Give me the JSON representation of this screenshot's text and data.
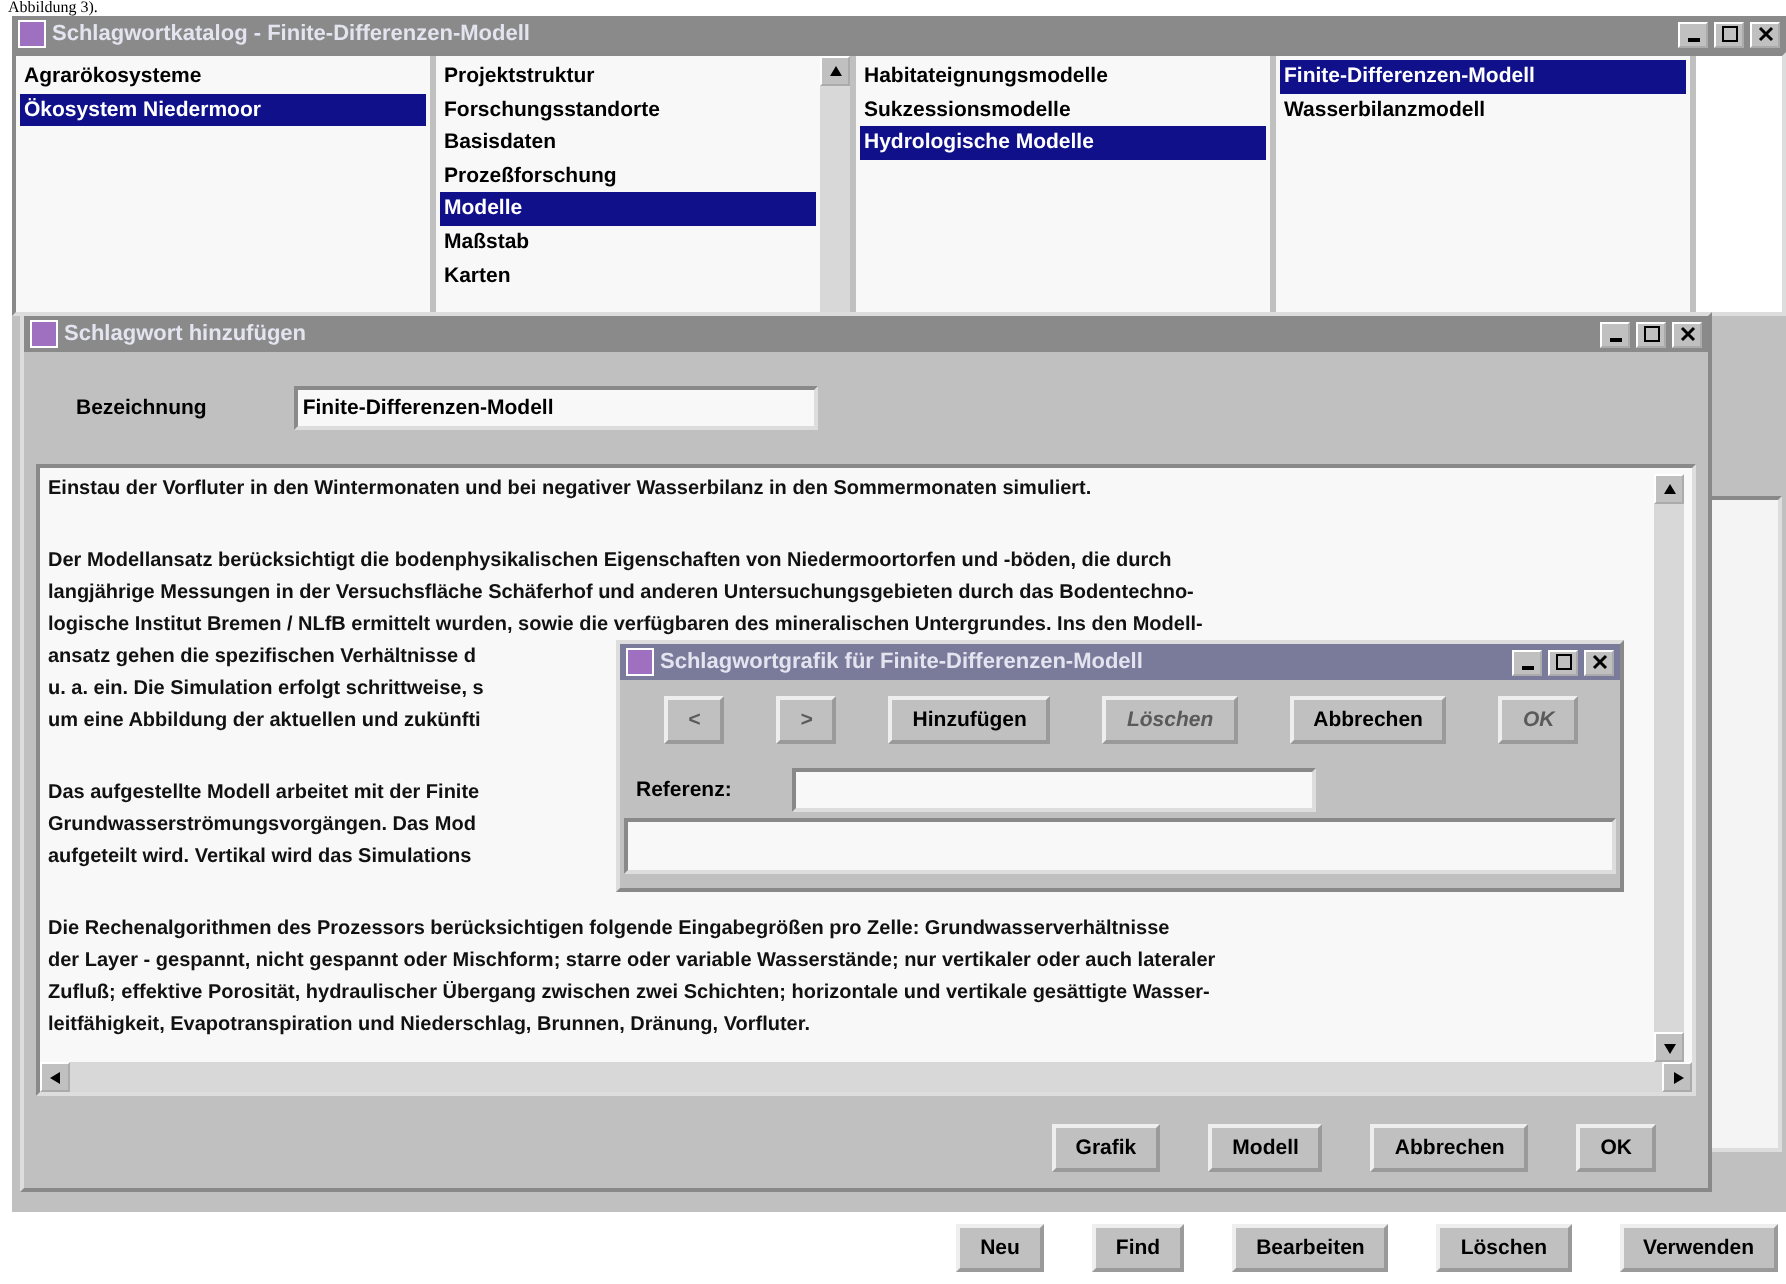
{
  "caption": "Abbildung 3).",
  "window": {
    "title": "Schlagwortkatalog - Finite-Differenzen-Modell"
  },
  "lists": [
    {
      "has_scrollbar": false,
      "items": [
        {
          "label": "Agrarökosysteme",
          "selected": false
        },
        {
          "label": "Ökosystem Niedermoor",
          "selected": true
        }
      ]
    },
    {
      "has_scrollbar": true,
      "items": [
        {
          "label": "Projektstruktur",
          "selected": false
        },
        {
          "label": "Forschungsstandorte",
          "selected": false
        },
        {
          "label": "Basisdaten",
          "selected": false
        },
        {
          "label": "Prozeßforschung",
          "selected": false
        },
        {
          "label": "Modelle",
          "selected": true
        },
        {
          "label": "Maßstab",
          "selected": false
        },
        {
          "label": "Karten",
          "selected": false
        }
      ]
    },
    {
      "has_scrollbar": false,
      "items": [
        {
          "label": "Habitateignungsmodelle",
          "selected": false
        },
        {
          "label": "Sukzessionsmodelle",
          "selected": false
        },
        {
          "label": "Hydrologische Modelle",
          "selected": true
        }
      ]
    },
    {
      "has_scrollbar": false,
      "items": [
        {
          "label": "Finite-Differenzen-Modell",
          "selected": true
        },
        {
          "label": "Wasserbilanzmodell",
          "selected": false
        }
      ]
    }
  ],
  "dialog": {
    "title": "Schlagwort hinzufügen",
    "name_label": "Bezeichnung",
    "name_value": "Finite-Differenzen-Modell",
    "paragraphs": [
      [
        "Einstau der Vorfluter in den Wintermonaten und bei negativer Wasserbilanz in den Sommermonaten simuliert."
      ],
      [
        "Der Modellansatz berücksichtigt die bodenphysikalischen Eigenschaften von Niedermoortorfen und -böden, die durch",
        "langjährige Messungen in der Versuchsfläche Schäferhof und anderen Untersuchungsgebieten durch das Bodentechno-",
        "logische Institut Bremen / NLfB ermittelt wurden, sowie die verfügbaren des mineralischen Untergrundes. Ins den Modell-",
        "ansatz gehen die spezifischen Verhältnisse d",
        "u. a. ein. Die Simulation erfolgt schrittweise, s",
        "um eine Abbildung der aktuellen und zukünfti"
      ],
      [
        "Das aufgestellte Modell arbeitet mit der Finite",
        "Grundwasserströmungsvorgängen. Das Mod",
        "aufgeteilt wird. Vertikal wird das Simulations"
      ],
      [
        "Die Rechenalgorithmen des Prozessors berücksichtigen folgende Eingabegrößen pro Zelle: Grundwasserverhältnisse",
        "der Layer - gespannt, nicht gespannt oder Mischform; starre oder variable Wasserstände; nur vertikaler oder auch lateraler",
        "Zufluß; effektive Porosität, hydraulischer Übergang zwischen zwei Schichten; horizontale und vertikale gesättigte Wasser-",
        "leitfähigkeit, Evapotranspiration und Niederschlag, Brunnen, Dränung, Vorfluter."
      ]
    ],
    "buttons": [
      {
        "label": "Grafik",
        "disabled": false
      },
      {
        "label": "Modell",
        "disabled": false
      },
      {
        "label": "Abbrechen",
        "disabled": false
      },
      {
        "label": "OK",
        "disabled": false
      }
    ]
  },
  "graphic_dialog": {
    "title": "Schlagwortgrafik für Finite-Differenzen-Modell",
    "buttons": [
      {
        "label": "<",
        "disabled": true
      },
      {
        "label": ">",
        "disabled": true
      },
      {
        "label": "Hinzufügen",
        "disabled": false
      },
      {
        "label": "Löschen",
        "disabled": true
      },
      {
        "label": "Abbrechen",
        "disabled": false
      },
      {
        "label": "OK",
        "disabled": true
      }
    ],
    "reference_label": "Referenz:"
  },
  "main_buttons": [
    {
      "label": "Neu",
      "disabled": false
    },
    {
      "label": "Find",
      "disabled": false
    },
    {
      "label": "Bearbeiten",
      "disabled": false
    },
    {
      "label": "Löschen",
      "disabled": false
    },
    {
      "label": "Verwenden",
      "disabled": false
    }
  ]
}
